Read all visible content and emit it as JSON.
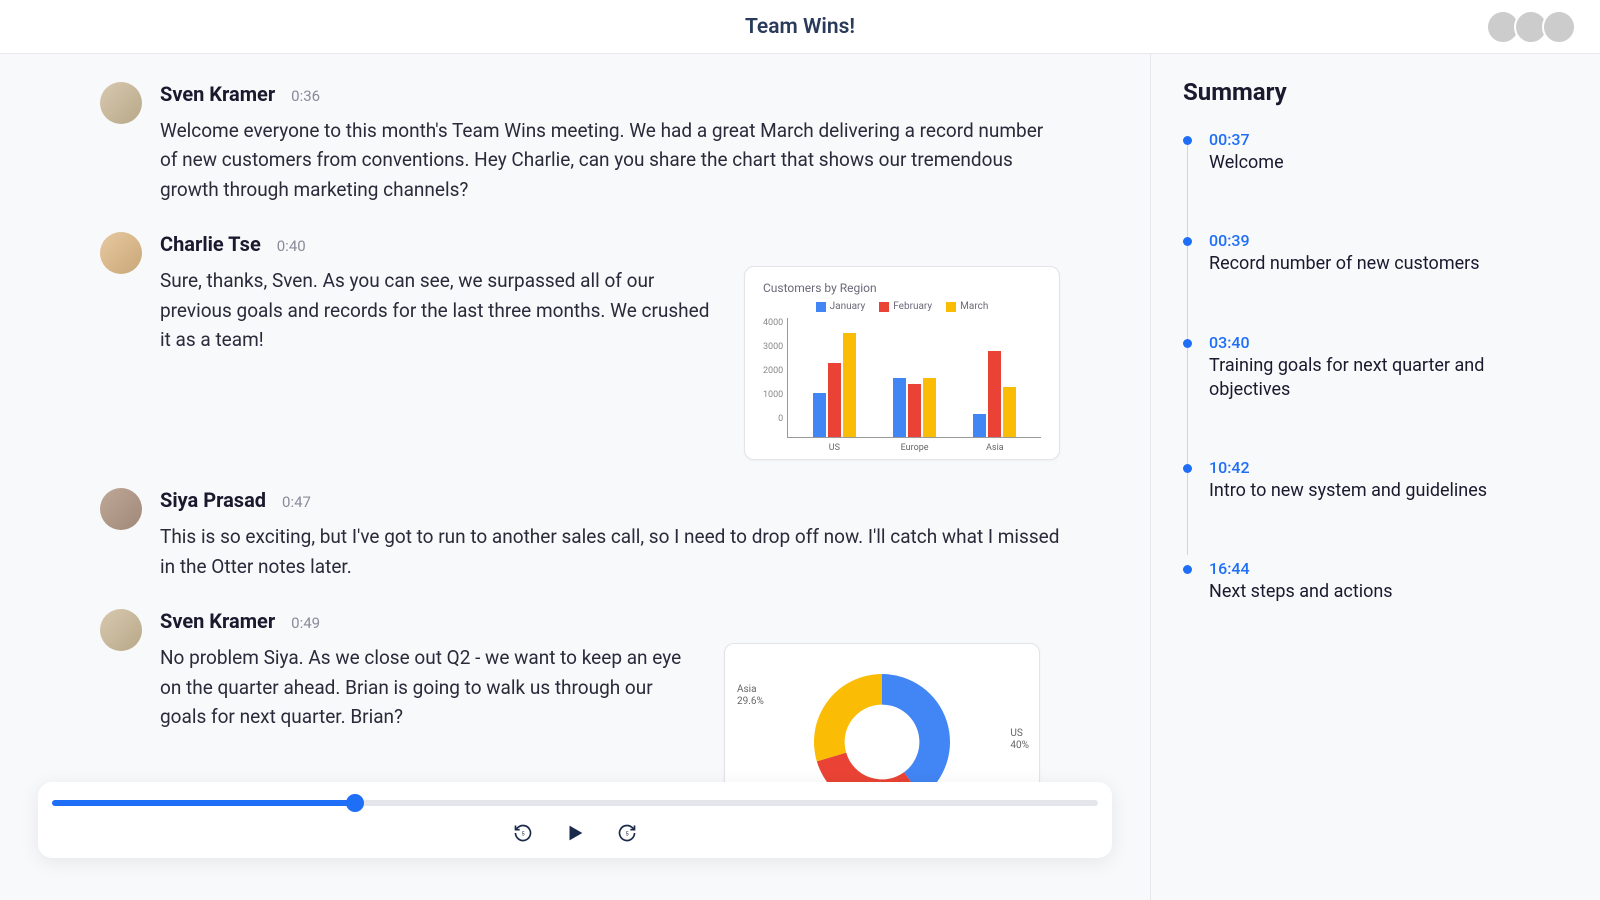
{
  "header": {
    "title": "Team Wins!",
    "participants": [
      {
        "name": "Siya Prasad"
      },
      {
        "name": "Sven Kramer"
      },
      {
        "name": "Charlie Tse"
      }
    ]
  },
  "colors": {
    "accent": "#1f6ef7",
    "series_january": "#4285f4",
    "series_february": "#ea4335",
    "series_march": "#fbbc05"
  },
  "transcript": [
    {
      "speaker": "Sven Kramer",
      "time": "0:36",
      "text": "Welcome everyone to this month's Team Wins meeting. We had a great March delivering a record number of new customers from conventions. Hey Charlie, can you share the chart that shows our tremendous growth through marketing channels?"
    },
    {
      "speaker": "Charlie Tse",
      "time": "0:40",
      "text": "Sure, thanks, Sven. As you can see, we surpassed all of our previous goals and records for the last three months. We crushed it as a team!",
      "attachment": "bar_chart"
    },
    {
      "speaker": "Siya Prasad",
      "time": "0:47",
      "text": "This is so exciting, but I've got to run to another sales call, so I need to drop off now. I'll catch what I missed in the Otter notes later."
    },
    {
      "speaker": "Sven Kramer",
      "time": "0:49",
      "text": "No problem Siya. As we close out Q2 - we want to keep an eye on the quarter ahead. Brian is going to walk us through our goals for next quarter. Brian?",
      "attachment": "donut_chart"
    }
  ],
  "chart_data": [
    {
      "type": "bar",
      "title": "Customers by Region",
      "categories": [
        "US",
        "Europe",
        "Asia"
      ],
      "series": [
        {
          "name": "January",
          "color": "#4285f4",
          "values": [
            1500,
            2000,
            800
          ]
        },
        {
          "name": "February",
          "color": "#ea4335",
          "values": [
            2500,
            1800,
            2900
          ]
        },
        {
          "name": "March",
          "color": "#fbbc05",
          "values": [
            3500,
            2000,
            1700
          ]
        }
      ],
      "ylabel": "",
      "xlabel": "",
      "ylim": [
        0,
        4000
      ],
      "yticks": [
        0,
        1000,
        2000,
        3000,
        4000
      ]
    },
    {
      "type": "pie",
      "title": "",
      "slices": [
        {
          "name": "US",
          "value": 40.0,
          "color": "#4285f4"
        },
        {
          "name": "Europe",
          "value": 30.4,
          "color": "#ea4335"
        },
        {
          "name": "Asia",
          "value": 29.6,
          "color": "#fbbc05"
        }
      ]
    }
  ],
  "summary": {
    "heading": "Summary",
    "items": [
      {
        "time": "00:37",
        "title": "Welcome"
      },
      {
        "time": "00:39",
        "title": "Record number of new customers"
      },
      {
        "time": "03:40",
        "title": "Training goals for next quarter and objectives"
      },
      {
        "time": "10:42",
        "title": "Intro to new system and guidelines"
      },
      {
        "time": "16:44",
        "title": "Next steps and actions"
      }
    ]
  },
  "player": {
    "progress_percent": 29,
    "rewind_label": "5",
    "forward_label": "5"
  }
}
